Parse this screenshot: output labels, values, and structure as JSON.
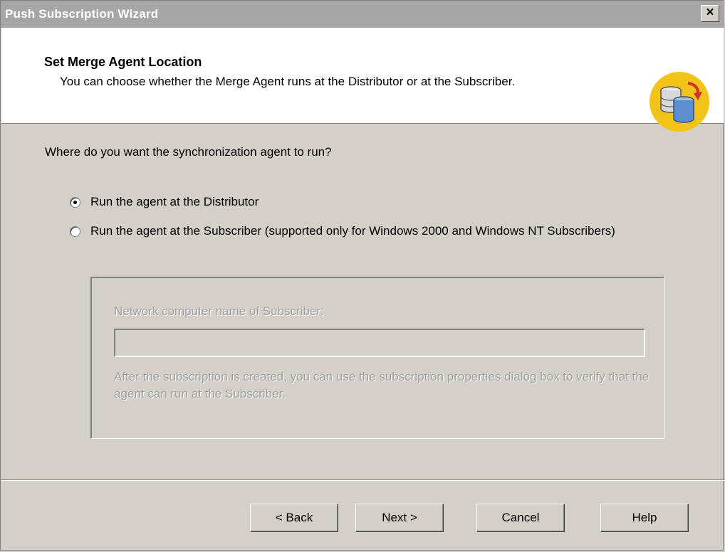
{
  "window": {
    "title": "Push Subscription Wizard",
    "close_label": "×"
  },
  "header": {
    "title": "Set Merge Agent Location",
    "description": "You can choose whether the Merge Agent runs at the Distributor or at the Subscriber.",
    "icon": "database-sync-icon"
  },
  "body": {
    "question": "Where do you want the synchronization agent to run?",
    "options": [
      {
        "label": "Run the agent at the Distributor",
        "selected": true
      },
      {
        "label": "Run the agent at the Subscriber (supported only for Windows 2000 and Windows NT Subscribers)",
        "selected": false
      }
    ],
    "subscriber_group": {
      "field_label": "Network computer name of Subscriber:",
      "field_value": "",
      "note": "After the subscription is created, you can use the subscription properties dialog box to verify that the agent can run at the Subscriber."
    }
  },
  "buttons": {
    "back": "< Back",
    "next": "Next >",
    "cancel": "Cancel",
    "help": "Help"
  },
  "colors": {
    "dialog_bg": "#d4d0c8",
    "titlebar_inactive": "#a6a6a6",
    "header_bg": "#ffffff",
    "icon_bg": "#f2c318",
    "disabled_text": "#a0a0a0"
  }
}
